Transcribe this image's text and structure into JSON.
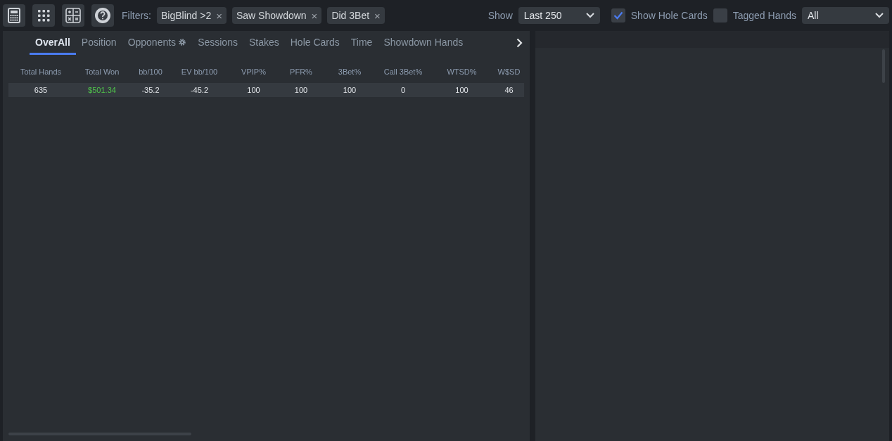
{
  "toolbar": {
    "tools": [
      {
        "kind": "calculator"
      },
      {
        "kind": "grid"
      },
      {
        "kind": "math"
      },
      {
        "kind": "help"
      }
    ],
    "filters_label": "Filters:",
    "filters": [
      {
        "label": "BigBlind >2",
        "remove": "×"
      },
      {
        "label": "Saw Showdown",
        "remove": "×"
      },
      {
        "label": "Did 3Bet",
        "remove": "×"
      }
    ],
    "show_label": "Show",
    "show_value": "Last 250",
    "show_hole_cards": {
      "label": "Show Hole Cards",
      "checked": true
    },
    "tagged_hands": {
      "label": "Tagged Hands",
      "checked": false
    },
    "tag_value": "All"
  },
  "tabs": [
    {
      "label": "OverAll",
      "selected": true,
      "gear": false
    },
    {
      "label": "Position",
      "selected": false,
      "gear": false
    },
    {
      "label": "Opponents",
      "selected": false,
      "gear": true
    },
    {
      "label": "Sessions",
      "selected": false,
      "gear": false
    },
    {
      "label": "Stakes",
      "selected": false,
      "gear": false
    },
    {
      "label": "Hole Cards",
      "selected": false,
      "gear": false
    },
    {
      "label": "Time",
      "selected": false,
      "gear": false
    },
    {
      "label": "Showdown Hands",
      "selected": false,
      "gear": false
    }
  ],
  "table": {
    "columns": [
      "Total Hands",
      "Total Won",
      "bb/100",
      "EV bb/100",
      "VPIP%",
      "PFR%",
      "3Bet%",
      "Call 3Bet%",
      "WTSD%",
      "W$SD"
    ],
    "rows": [
      {
        "cells": [
          "635",
          "$501.34",
          "-35.2",
          "-45.2",
          "100",
          "100",
          "100",
          "0",
          "100",
          "46"
        ],
        "positive": [
          false,
          true,
          false,
          false,
          false,
          false,
          false,
          false,
          false,
          false
        ]
      }
    ]
  }
}
